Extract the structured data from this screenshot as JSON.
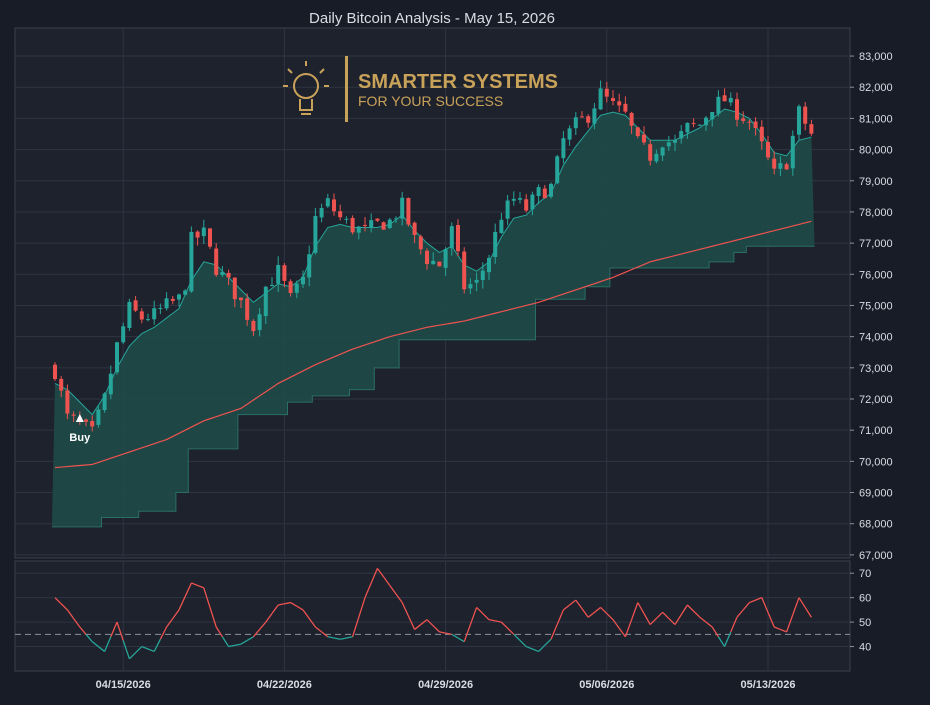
{
  "chart_data": [
    {
      "type": "candlestick",
      "title": "Daily Bitcoin Analysis - May 15, 2026",
      "x_tick_labels": [
        "04/15/2026",
        "04/22/2026",
        "04/29/2026",
        "05/06/2026",
        "05/13/2026"
      ],
      "y_tick_labels": [
        "67,000",
        "68,000",
        "69,000",
        "70,000",
        "71,000",
        "72,000",
        "73,000",
        "74,000",
        "75,000",
        "76,000",
        "77,000",
        "78,000",
        "79,000",
        "80,000",
        "81,000",
        "82,000",
        "83,000"
      ],
      "ylim": [
        66900,
        83900
      ],
      "grid": true,
      "close_path": [
        [
          0,
          72900
        ],
        [
          2,
          71400
        ],
        [
          4,
          71200
        ],
        [
          6,
          70900
        ],
        [
          8,
          72000
        ],
        [
          10,
          73700
        ],
        [
          12,
          74900
        ],
        [
          14,
          74600
        ],
        [
          16,
          74700
        ],
        [
          18,
          75000
        ],
        [
          20,
          75200
        ],
        [
          21,
          75700
        ],
        [
          22,
          77100
        ],
        [
          24,
          77300
        ],
        [
          26,
          76200
        ],
        [
          28,
          75700
        ],
        [
          30,
          75100
        ],
        [
          32,
          74300
        ],
        [
          34,
          75600
        ],
        [
          36,
          76100
        ],
        [
          38,
          75200
        ],
        [
          40,
          75800
        ],
        [
          42,
          77800
        ],
        [
          44,
          78300
        ],
        [
          46,
          77800
        ],
        [
          48,
          77500
        ],
        [
          50,
          77400
        ],
        [
          52,
          77600
        ],
        [
          54,
          77700
        ],
        [
          56,
          78200
        ],
        [
          58,
          77100
        ],
        [
          60,
          76500
        ],
        [
          62,
          76300
        ],
        [
          64,
          77400
        ],
        [
          66,
          75600
        ],
        [
          68,
          75700
        ],
        [
          70,
          76600
        ],
        [
          72,
          77900
        ],
        [
          74,
          78400
        ],
        [
          76,
          78100
        ],
        [
          78,
          78600
        ],
        [
          80,
          78800
        ],
        [
          82,
          80300
        ],
        [
          84,
          80800
        ],
        [
          86,
          81100
        ],
        [
          88,
          81800
        ],
        [
          90,
          81400
        ],
        [
          92,
          81100
        ],
        [
          94,
          80200
        ],
        [
          96,
          79800
        ],
        [
          98,
          80300
        ],
        [
          100,
          80200
        ],
        [
          102,
          80700
        ],
        [
          104,
          80800
        ],
        [
          106,
          81400
        ],
        [
          108,
          81600
        ],
        [
          110,
          81200
        ],
        [
          112,
          80900
        ],
        [
          114,
          80100
        ],
        [
          116,
          79200
        ],
        [
          118,
          79600
        ],
        [
          120,
          81200
        ],
        [
          122,
          80500
        ]
      ],
      "markers": [
        {
          "label": "Buy",
          "type": "triangle-up",
          "x": 4,
          "y": 71200
        }
      ],
      "series": [
        {
          "kind": "ema-fast",
          "color": "#26a69a",
          "points": [
            [
              0,
              72500
            ],
            [
              2,
              72300
            ],
            [
              4,
              71900
            ],
            [
              6,
              71500
            ],
            [
              8,
              72100
            ],
            [
              10,
              73000
            ],
            [
              12,
              73700
            ],
            [
              14,
              74100
            ],
            [
              16,
              74300
            ],
            [
              18,
              74600
            ],
            [
              20,
              74900
            ],
            [
              22,
              75800
            ],
            [
              24,
              76400
            ],
            [
              26,
              76300
            ],
            [
              28,
              75900
            ],
            [
              30,
              75500
            ],
            [
              32,
              75100
            ],
            [
              34,
              75400
            ],
            [
              36,
              75700
            ],
            [
              38,
              75600
            ],
            [
              40,
              75900
            ],
            [
              42,
              76900
            ],
            [
              44,
              77500
            ],
            [
              46,
              77600
            ],
            [
              48,
              77500
            ],
            [
              50,
              77500
            ],
            [
              52,
              77500
            ],
            [
              54,
              77600
            ],
            [
              56,
              77900
            ],
            [
              58,
              77400
            ],
            [
              60,
              77000
            ],
            [
              62,
              76700
            ],
            [
              64,
              76900
            ],
            [
              66,
              76300
            ],
            [
              68,
              76100
            ],
            [
              70,
              76400
            ],
            [
              72,
              77200
            ],
            [
              74,
              77800
            ],
            [
              76,
              77900
            ],
            [
              78,
              78300
            ],
            [
              80,
              78600
            ],
            [
              82,
              79500
            ],
            [
              84,
              80100
            ],
            [
              86,
              80600
            ],
            [
              88,
              81100
            ],
            [
              90,
              81200
            ],
            [
              92,
              81100
            ],
            [
              94,
              80700
            ],
            [
              96,
              80300
            ],
            [
              98,
              80300
            ],
            [
              100,
              80300
            ],
            [
              102,
              80500
            ],
            [
              104,
              80700
            ],
            [
              106,
              81000
            ],
            [
              108,
              81300
            ],
            [
              110,
              81200
            ],
            [
              112,
              81000
            ],
            [
              114,
              80500
            ],
            [
              116,
              79900
            ],
            [
              118,
              79800
            ],
            [
              120,
              80300
            ],
            [
              122,
              80400
            ]
          ]
        },
        {
          "kind": "sma-slow",
          "color": "#ef5350",
          "points": [
            [
              0,
              69800
            ],
            [
              6,
              69900
            ],
            [
              12,
              70300
            ],
            [
              18,
              70700
            ],
            [
              24,
              71300
            ],
            [
              30,
              71700
            ],
            [
              36,
              72500
            ],
            [
              42,
              73100
            ],
            [
              48,
              73600
            ],
            [
              54,
              74000
            ],
            [
              60,
              74300
            ],
            [
              66,
              74500
            ],
            [
              72,
              74800
            ],
            [
              78,
              75100
            ],
            [
              84,
              75500
            ],
            [
              90,
              75900
            ],
            [
              96,
              76400
            ],
            [
              102,
              76700
            ],
            [
              108,
              77000
            ],
            [
              114,
              77300
            ],
            [
              120,
              77600
            ],
            [
              122,
              77700
            ]
          ]
        },
        {
          "kind": "trailing-stop",
          "color": "#1f5f57",
          "points": [
            [
              0,
              67900
            ],
            [
              8,
              68200
            ],
            [
              14,
              68400
            ],
            [
              20,
              69000
            ],
            [
              22,
              70400
            ],
            [
              28,
              70400
            ],
            [
              30,
              71500
            ],
            [
              36,
              71500
            ],
            [
              38,
              71900
            ],
            [
              42,
              72100
            ],
            [
              48,
              72300
            ],
            [
              52,
              73000
            ],
            [
              56,
              73900
            ],
            [
              76,
              73900
            ],
            [
              78,
              75200
            ],
            [
              86,
              75600
            ],
            [
              90,
              76200
            ],
            [
              106,
              76400
            ],
            [
              110,
              76700
            ],
            [
              112,
              76900
            ],
            [
              122,
              76900
            ]
          ]
        },
        {
          "kind": "oscillator",
          "color": "#ef5350",
          "ylim": [
            30,
            75
          ],
          "reference_line": 45,
          "points": [
            [
              0,
              60
            ],
            [
              2,
              55
            ],
            [
              4,
              48
            ],
            [
              6,
              42
            ],
            [
              8,
              38
            ],
            [
              10,
              50
            ],
            [
              12,
              35
            ],
            [
              14,
              40
            ],
            [
              16,
              38
            ],
            [
              18,
              48
            ],
            [
              20,
              55
            ],
            [
              22,
              66
            ],
            [
              24,
              64
            ],
            [
              26,
              48
            ],
            [
              28,
              40
            ],
            [
              30,
              41
            ],
            [
              32,
              44
            ],
            [
              34,
              50
            ],
            [
              36,
              57
            ],
            [
              38,
              58
            ],
            [
              40,
              55
            ],
            [
              42,
              48
            ],
            [
              44,
              44
            ],
            [
              46,
              43
            ],
            [
              48,
              44
            ],
            [
              50,
              60
            ],
            [
              52,
              72
            ],
            [
              54,
              65
            ],
            [
              56,
              58
            ],
            [
              58,
              47
            ],
            [
              60,
              51
            ],
            [
              62,
              46
            ],
            [
              64,
              45
            ],
            [
              66,
              42
            ],
            [
              68,
              56
            ],
            [
              70,
              51
            ],
            [
              72,
              50
            ],
            [
              74,
              45
            ],
            [
              76,
              40
            ],
            [
              78,
              38
            ],
            [
              80,
              43
            ],
            [
              82,
              55
            ],
            [
              84,
              59
            ],
            [
              86,
              52
            ],
            [
              88,
              56
            ],
            [
              90,
              51
            ],
            [
              92,
              44
            ],
            [
              94,
              58
            ],
            [
              96,
              49
            ],
            [
              98,
              54
            ],
            [
              100,
              49
            ],
            [
              102,
              57
            ],
            [
              104,
              52
            ],
            [
              106,
              48
            ],
            [
              108,
              40
            ],
            [
              110,
              52
            ],
            [
              112,
              58
            ],
            [
              114,
              60
            ],
            [
              116,
              48
            ],
            [
              118,
              46
            ],
            [
              120,
              60
            ],
            [
              122,
              52
            ]
          ]
        }
      ],
      "colors": {
        "up": "#26a69a",
        "down": "#ef5350",
        "fill": "#1f4c4a",
        "grid": "#2e3442",
        "text": "#d9dce3"
      }
    }
  ],
  "logo": {
    "line1": "SMARTER SYSTEMS",
    "line2": "FOR YOUR SUCCESS"
  }
}
